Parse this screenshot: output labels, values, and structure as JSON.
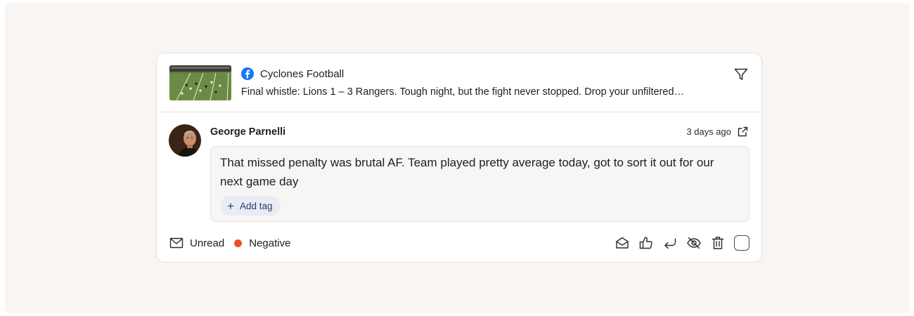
{
  "post": {
    "source_icon": "facebook-icon",
    "source_name": "Cyclones Football",
    "text": "Final whistle: Lions 1 – 3 Rangers. Tough night, but the fight never stopped. Drop your unfiltered…",
    "thumbnail": "football-field-photo"
  },
  "comment": {
    "author": "George Parnelli",
    "time": "3 days ago",
    "text": "That missed penalty was brutal AF. Team played pretty average today, got to sort it out for our next game day",
    "add_tag_label": "Add tag"
  },
  "footer": {
    "read_status": "Unread",
    "sentiment": "Negative",
    "sentiment_color": "#f04e23"
  },
  "icons": {
    "filter": "filter-icon",
    "external_link": "external-link-icon",
    "mail": "mail-icon",
    "mark_read": "envelope-open-icon",
    "like": "thumbs-up-icon",
    "reply": "reply-icon",
    "hide": "eye-off-icon",
    "delete": "trash-icon"
  }
}
